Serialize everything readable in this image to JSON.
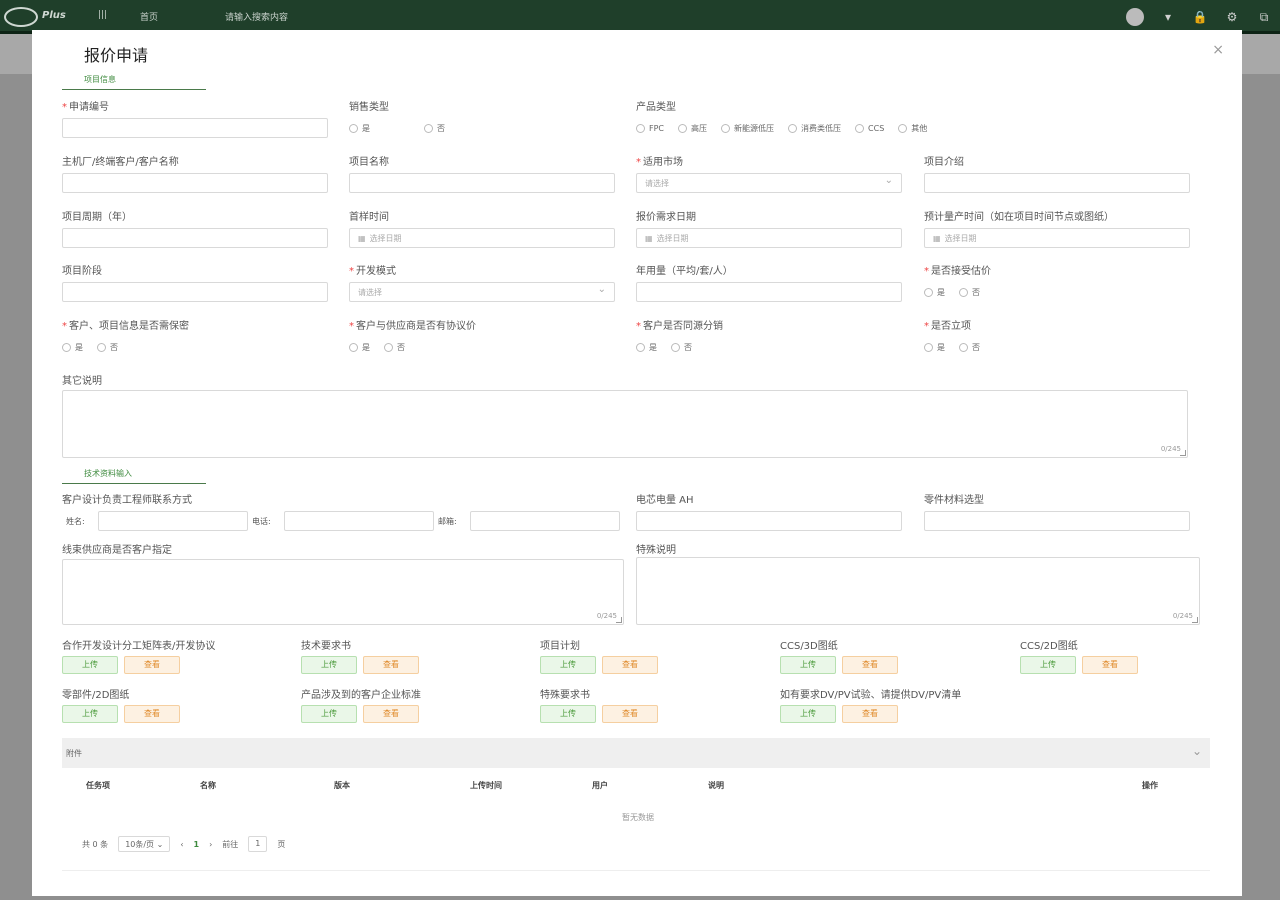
{
  "topbar": {
    "logo_text": "Plus",
    "menu_home": "首页",
    "search_placeholder": "请输入搜索内容"
  },
  "modal": {
    "title": "报价申请",
    "close": "×"
  },
  "sections": {
    "project_info": "项目信息",
    "tech_input": "技术资料输入"
  },
  "form": {
    "order_no": {
      "label": "申请编号"
    },
    "sales_type": {
      "label": "销售类型",
      "options": [
        "是",
        "否"
      ]
    },
    "product_type": {
      "label": "产品类型",
      "options": [
        "FPC",
        "高压",
        "新能源低压",
        "消费类低压",
        "CCS",
        "其他"
      ]
    },
    "customer": {
      "label": "主机厂/终端客户/客户名称"
    },
    "project_name": {
      "label": "项目名称"
    },
    "market": {
      "label": "适用市场",
      "placeholder": "请选择"
    },
    "project_intro": {
      "label": "项目介绍"
    },
    "cycle": {
      "label": "项目周期（年）"
    },
    "first_sample": {
      "label": "首样时间",
      "placeholder": "选择日期"
    },
    "quote_date": {
      "label": "报价需求日期",
      "placeholder": "选择日期"
    },
    "mass_prod": {
      "label": "预计量产时间（如在项目时间节点或图纸）",
      "placeholder": "选择日期"
    },
    "stage": {
      "label": "项目阶段"
    },
    "dev_mode": {
      "label": "开发模式",
      "placeholder": "请选择"
    },
    "annual_volume": {
      "label": "年用量（平均/套/人）"
    },
    "accept_estimate": {
      "label": "是否接受估价",
      "options": [
        "是",
        "否"
      ]
    },
    "confidential": {
      "label": "客户、项目信息是否需保密",
      "options": [
        "是",
        "否"
      ]
    },
    "agreement": {
      "label": "客户与供应商是否有协议价",
      "options": [
        "是",
        "否"
      ]
    },
    "same_source": {
      "label": "客户是否同源分销",
      "options": [
        "是",
        "否"
      ]
    },
    "approved": {
      "label": "是否立项",
      "options": [
        "是",
        "否"
      ]
    },
    "other_desc": {
      "label": "其它说明",
      "counter": "0/245"
    },
    "engineer_contact": {
      "label": "客户设计负责工程师联系方式",
      "name": "姓名:",
      "phone": "电话:",
      "email": "邮箱:"
    },
    "current": {
      "label": "电芯电量 AH"
    },
    "material": {
      "label": "零件材料选型"
    },
    "supplier_designated": {
      "label": "线束供应商是否客户指定",
      "counter": "0/245"
    },
    "special_desc": {
      "label": "特殊说明",
      "counter": "0/245"
    }
  },
  "uploads": [
    {
      "label": "合作开发设计分工矩阵表/开发协议",
      "upload": "上传",
      "view": "查看"
    },
    {
      "label": "技术要求书",
      "upload": "上传",
      "view": "查看"
    },
    {
      "label": "项目计划",
      "upload": "上传",
      "view": "查看"
    },
    {
      "label": "CCS/3D图纸",
      "upload": "上传",
      "view": "查看"
    },
    {
      "label": "CCS/2D图纸",
      "upload": "上传",
      "view": "查看"
    },
    {
      "label": "零部件/2D图纸",
      "upload": "上传",
      "view": "查看"
    },
    {
      "label": "产品涉及到的客户企业标准",
      "upload": "上传",
      "view": "查看"
    },
    {
      "label": "特殊要求书",
      "upload": "上传",
      "view": "查看"
    },
    {
      "label": "如有要求DV/PV试验、请提供DV/PV清单",
      "upload": "上传",
      "view": "查看"
    }
  ],
  "attachments": {
    "title": "附件",
    "columns": [
      "任务项",
      "名称",
      "版本",
      "上传时间",
      "用户",
      "说明",
      "操作"
    ],
    "empty": "暂无数据",
    "pager": {
      "total": "共 0 条",
      "page_size": "10条/页",
      "current": "1",
      "goto": "前往",
      "page_input": "1",
      "page_unit": "页"
    }
  }
}
